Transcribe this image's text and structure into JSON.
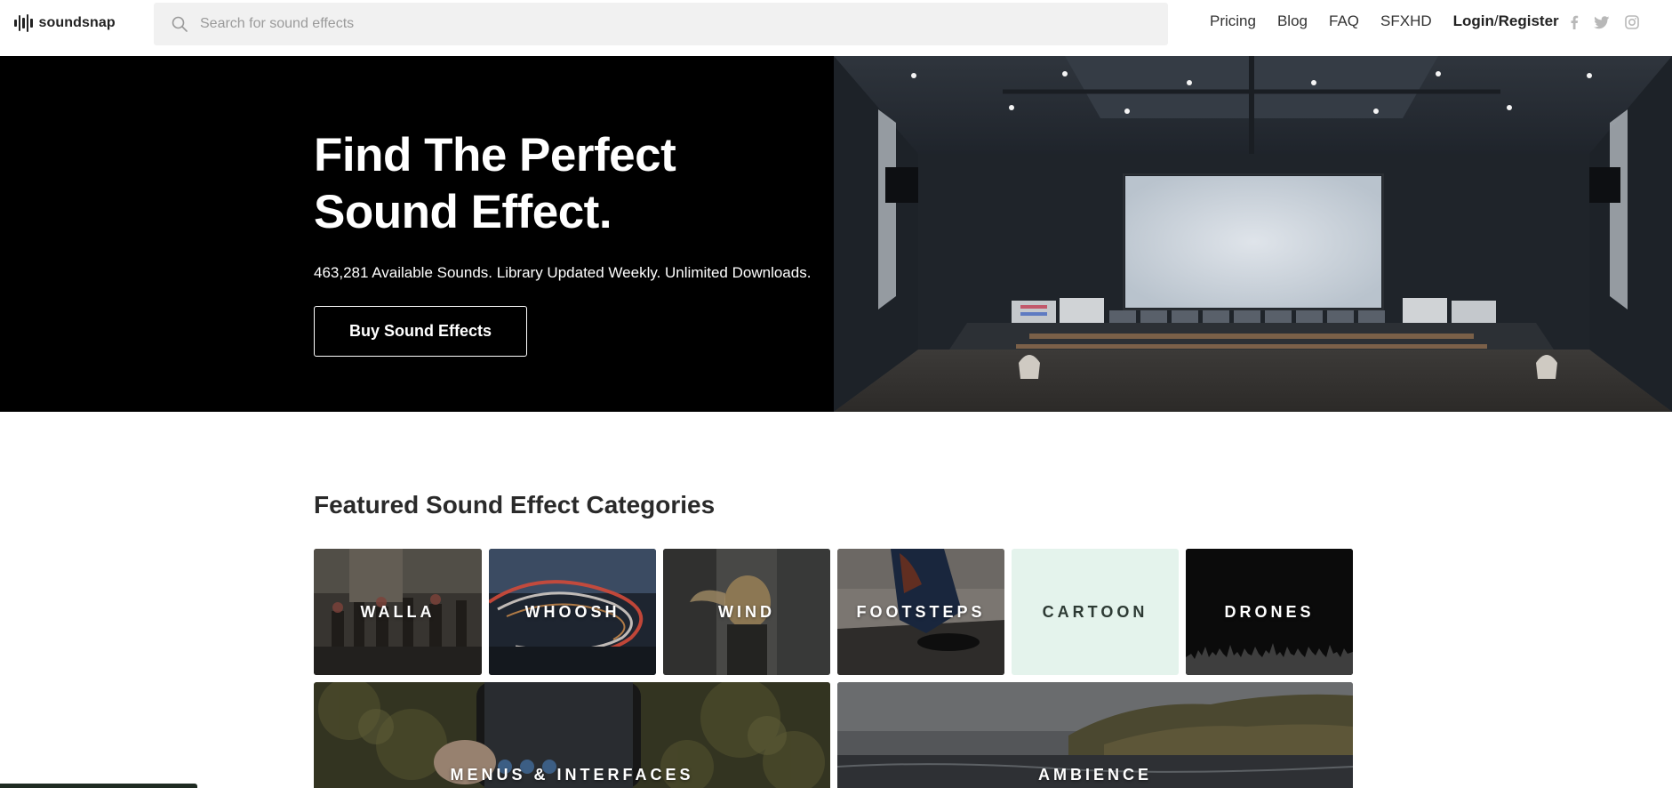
{
  "header": {
    "logo_text": "soundsnap",
    "search_placeholder": "Search for sound effects",
    "nav": [
      {
        "label": "Pricing"
      },
      {
        "label": "Blog"
      },
      {
        "label": "FAQ"
      },
      {
        "label": "SFXHD"
      }
    ],
    "login_label": "Login",
    "login_separator": "/",
    "register_label": "Register",
    "social_icons": [
      "facebook-icon",
      "twitter-icon",
      "instagram-icon"
    ]
  },
  "hero": {
    "title_line1": "Find The Perfect",
    "title_line2": "Sound Effect.",
    "subtitle": "463,281 Available Sounds. Library Updated Weekly. Unlimited Downloads.",
    "button_label": "Buy Sound Effects"
  },
  "featured": {
    "title": "Featured Sound Effect Categories",
    "categories": [
      {
        "label": "WALLA"
      },
      {
        "label": "WHOOSH"
      },
      {
        "label": "WIND"
      },
      {
        "label": "FOOTSTEPS"
      },
      {
        "label": "CARTOON"
      },
      {
        "label": "DRONES"
      },
      {
        "label": "MENUS & INTERFACES"
      },
      {
        "label": "AMBIENCE"
      }
    ]
  },
  "colors": {
    "hero_background": "#000000",
    "search_background": "#f1f1f1",
    "cartoon_tile": "#e4f3ec",
    "drones_tile": "#0b0b0b"
  }
}
